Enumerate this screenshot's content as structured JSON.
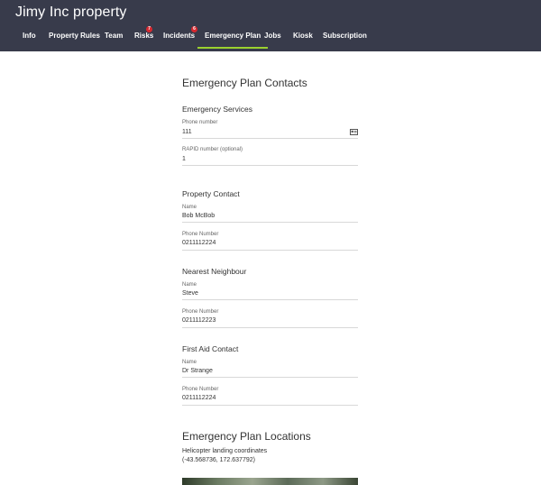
{
  "header": {
    "title": "Jimy Inc property",
    "tabs": [
      {
        "label": "Info"
      },
      {
        "label": "Property Rules"
      },
      {
        "label": "Team"
      },
      {
        "label": "Risks",
        "badge": "7"
      },
      {
        "label": "Incidents",
        "badge": "6"
      },
      {
        "label": "Emergency Plan",
        "active": true
      },
      {
        "label": "Jobs"
      },
      {
        "label": "Kiosk"
      },
      {
        "label": "Subscription"
      }
    ]
  },
  "contacts": {
    "title": "Emergency Plan Contacts",
    "emergency_services": {
      "heading": "Emergency Services",
      "phone_label": "Phone number",
      "phone_value": "111",
      "rapid_label": "RAPID number (optional)",
      "rapid_value": "1"
    },
    "property_contact": {
      "heading": "Property Contact",
      "name_label": "Name",
      "name_value": "Bob McBob",
      "phone_label": "Phone Number",
      "phone_value": "0211112224"
    },
    "nearest_neighbour": {
      "heading": "Nearest Neighbour",
      "name_label": "Name",
      "name_value": "Steve",
      "phone_label": "Phone Number",
      "phone_value": "0211112223"
    },
    "first_aid": {
      "heading": "First Aid Contact",
      "name_label": "Name",
      "name_value": "Dr Strange",
      "phone_label": "Phone Number",
      "phone_value": "0211112224"
    }
  },
  "locations": {
    "title": "Emergency Plan Locations",
    "helicopter_label": "Helicopter landing coordinates",
    "helicopter_coords": "(-43.568736, 172.637792)"
  },
  "icons": {
    "phone_field_icon": "contact-card-icon"
  },
  "colors": {
    "header_bg": "#383b4b",
    "active_tab_underline": "#9bd12f",
    "badge": "#d7282f"
  }
}
